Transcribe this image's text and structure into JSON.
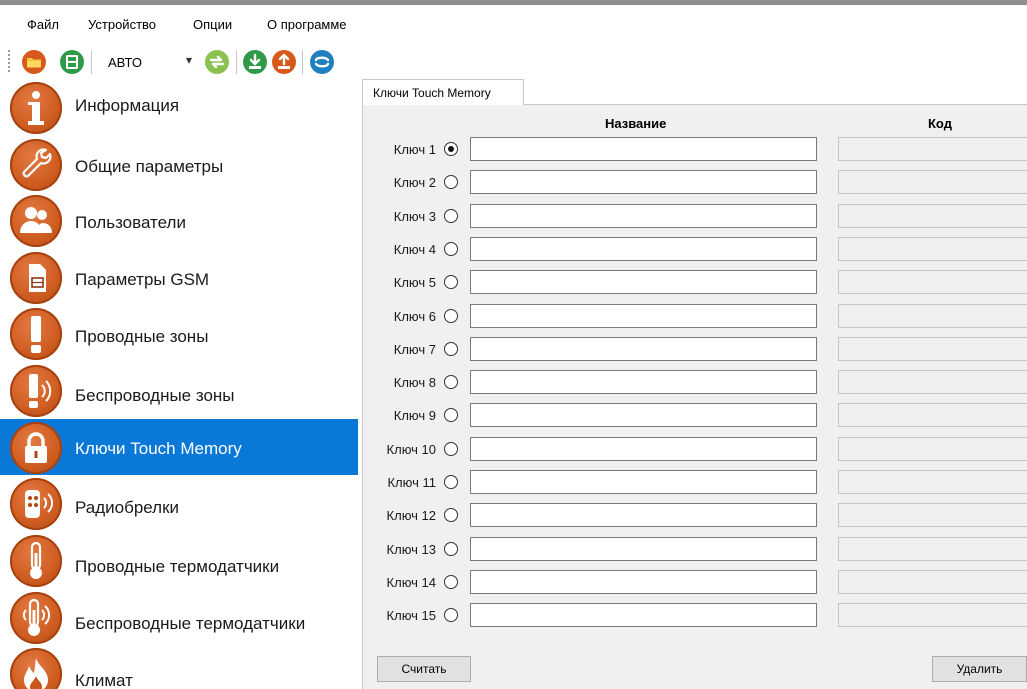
{
  "menu": {
    "file": "Файл",
    "device": "Устройство",
    "options": "Опции",
    "about": "О программе"
  },
  "toolbar": {
    "mode_value": "АВТО",
    "icons": [
      "open-folder-icon",
      "save-device-icon",
      "exchange-icon",
      "download-icon",
      "upload-icon",
      "sync-icon"
    ]
  },
  "sidebar": {
    "active": "Ключи Touch Memory",
    "items": [
      {
        "label": "Информация",
        "icon": "info-icon"
      },
      {
        "label": "Общие параметры",
        "icon": "wrench-icon"
      },
      {
        "label": "Пользователи",
        "icon": "users-icon"
      },
      {
        "label": "Параметры GSM",
        "icon": "sim-card-icon"
      },
      {
        "label": "Проводные зоны",
        "icon": "exclamation-icon"
      },
      {
        "label": "Беспроводные зоны",
        "icon": "wireless-exclamation-icon"
      },
      {
        "label": "Ключи Touch Memory",
        "icon": "lock-icon"
      },
      {
        "label": "Радиобрелки",
        "icon": "remote-fob-icon"
      },
      {
        "label": "Проводные термодатчики",
        "icon": "thermometer-icon"
      },
      {
        "label": "Беспроводные термодатчики",
        "icon": "wireless-thermometer-icon"
      },
      {
        "label": "Климат",
        "icon": "flame-icon"
      }
    ]
  },
  "tab": {
    "label": "Ключи Touch Memory"
  },
  "table": {
    "name_header": "Название",
    "code_header": "Код",
    "selected_key": 1,
    "rows": [
      {
        "label": "Ключ 1",
        "name": "",
        "code": ""
      },
      {
        "label": "Ключ 2",
        "name": "",
        "code": ""
      },
      {
        "label": "Ключ 3",
        "name": "",
        "code": ""
      },
      {
        "label": "Ключ 4",
        "name": "",
        "code": ""
      },
      {
        "label": "Ключ 5",
        "name": "",
        "code": ""
      },
      {
        "label": "Ключ 6",
        "name": "",
        "code": ""
      },
      {
        "label": "Ключ 7",
        "name": "",
        "code": ""
      },
      {
        "label": "Ключ 8",
        "name": "",
        "code": ""
      },
      {
        "label": "Ключ 9",
        "name": "",
        "code": ""
      },
      {
        "label": "Ключ 10",
        "name": "",
        "code": ""
      },
      {
        "label": "Ключ 11",
        "name": "",
        "code": ""
      },
      {
        "label": "Ключ 12",
        "name": "",
        "code": ""
      },
      {
        "label": "Ключ 13",
        "name": "",
        "code": ""
      },
      {
        "label": "Ключ 14",
        "name": "",
        "code": ""
      },
      {
        "label": "Ключ 15",
        "name": "",
        "code": ""
      }
    ]
  },
  "buttons": {
    "read": "Считать",
    "delete": "Удалить"
  },
  "colors": {
    "accent": "#0a78d7",
    "icon_orange": "#d05e22",
    "panel_bg": "#f0f0f0"
  }
}
